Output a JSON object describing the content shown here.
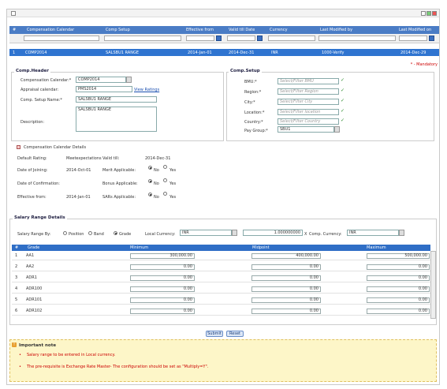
{
  "grid": {
    "columns": [
      "#",
      "Compensation Calendar",
      "Comp Setup",
      "Effective from",
      "Valid till Date",
      "Currency",
      "Last Modified by",
      "Last Modified on"
    ],
    "selected_row": {
      "num": "1",
      "calendar": "COMP2014",
      "setup": "SALSBU1 RANGE",
      "effective_from": "2014-Jan-01",
      "valid_till": "2014-Dec-31",
      "currency": "INR",
      "modified_by": "1000-Verify",
      "modified_on": "2014-Dec-29"
    }
  },
  "mandatory_note": "* - Mandatory",
  "comp_header": {
    "title": "Comp.Header",
    "calendar_label": "Compensation Calendar:*",
    "calendar_value": "COMP2014",
    "appraisal_label": "Appraisal calendar:",
    "appraisal_value": "PMS2014",
    "view_ratings": "View Ratings",
    "setup_name_label": "Comp. Setup Name:*",
    "setup_name_value": "SALSBU1 RANGE",
    "description_label": "Description:",
    "description_value": "SALSBU1 RANGE"
  },
  "comp_setup": {
    "title": "Comp.Setup",
    "fields": [
      {
        "label": "BMU:*",
        "placeholder": "Select/Filter BMU"
      },
      {
        "label": "Region:*",
        "placeholder": "Select/Filter Region"
      },
      {
        "label": "City:*",
        "placeholder": "Select/Filter City"
      },
      {
        "label": "Location:*",
        "placeholder": "Select/Filter location"
      },
      {
        "label": "Country:*",
        "placeholder": "Select/Filter Country"
      }
    ],
    "pay_group_label": "Pay Group:*",
    "pay_group_value": "SBU1"
  },
  "calendar_details": {
    "title": "Compensation Calendar Details",
    "default_rating_label": "Default Rating:",
    "default_rating_value": "Meetexpectations",
    "valid_till_label": "Valid till:",
    "valid_till_value": "2014-Dec-31",
    "doj_label": "Date of Joining:",
    "doj_value": "2014-Oct-01",
    "merit_label": "Merit Applicable:",
    "doc_label": "Date of Confirmation:",
    "bonus_label": "Bonus Applicable:",
    "eff_label": "Effective from:",
    "eff_value": "2014-Jan-01",
    "sars_label": "SARs Applicable:",
    "no": "No",
    "yes": "Yes"
  },
  "salary_range": {
    "title": "Salary Range Details",
    "by_label": "Salary Range By:",
    "opt_position": "Position",
    "opt_band": "Band",
    "opt_grade": "Grade",
    "local_currency_label": "Local Currency:",
    "local_currency_value": "INR",
    "rate_value": "1.000000000",
    "x": "X",
    "comp_currency_label": "Comp. Currency:",
    "comp_currency_value": "INR",
    "columns": [
      "#",
      "Grade",
      "Minimum",
      "Midpoint",
      "Maximum"
    ],
    "rows": [
      {
        "n": "1",
        "grade": "AA1",
        "min": "300,000.00",
        "mid": "400,000.00",
        "max": "500,000.00"
      },
      {
        "n": "2",
        "grade": "AA2",
        "min": "0.00",
        "mid": "0.00",
        "max": "0.00"
      },
      {
        "n": "3",
        "grade": "ADR1",
        "min": "0.00",
        "mid": "0.00",
        "max": "0.00"
      },
      {
        "n": "4",
        "grade": "ADR100",
        "min": "0.00",
        "mid": "0.00",
        "max": "0.00"
      },
      {
        "n": "5",
        "grade": "ADR101",
        "min": "0.00",
        "mid": "0.00",
        "max": "0.00"
      },
      {
        "n": "6",
        "grade": "ADR102",
        "min": "0.00",
        "mid": "0.00",
        "max": "0.00"
      }
    ]
  },
  "buttons": {
    "submit": "Submit",
    "reset": "Reset"
  },
  "note": {
    "title": "Important note",
    "items": [
      "Salary range to be entered in Local currency.",
      "The pre-requisite is Exchange Rate Master- The configuration should be set as \"Multiply=Y\"."
    ]
  }
}
